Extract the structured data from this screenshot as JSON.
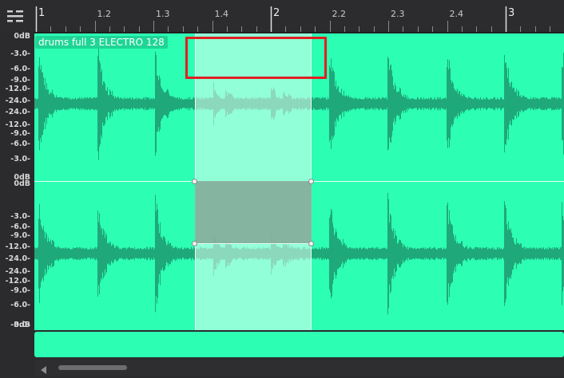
{
  "ruler": {
    "ticks": [
      {
        "label": "1",
        "pos": 1,
        "major": true
      },
      {
        "label": "1.2",
        "pos": 1.25,
        "major": false
      },
      {
        "label": "1.3",
        "pos": 1.5,
        "major": false
      },
      {
        "label": "1.4",
        "pos": 1.75,
        "major": false
      },
      {
        "label": "2",
        "pos": 2,
        "major": true
      },
      {
        "label": "2.2",
        "pos": 2.25,
        "major": false
      },
      {
        "label": "2.3",
        "pos": 2.5,
        "major": false
      },
      {
        "label": "2.4",
        "pos": 2.75,
        "major": false
      },
      {
        "label": "3",
        "pos": 3,
        "major": true
      }
    ]
  },
  "db_scale": {
    "labels": [
      "0dB",
      "-3.0-",
      "-6.0-",
      "-9.0-",
      "-12.0-",
      "-24.0-",
      "-24.0-",
      "-12.0-",
      "-9.0-",
      "-6.0-",
      "-3.0-",
      "0dB"
    ]
  },
  "clip": {
    "title": "drums full 3 ELECTRO 128",
    "color": "#2cffb4",
    "wave_color": "#1fa879"
  },
  "icons": {
    "menu": "menu-lines-icon",
    "scroll_left": "triangle-left-icon"
  }
}
